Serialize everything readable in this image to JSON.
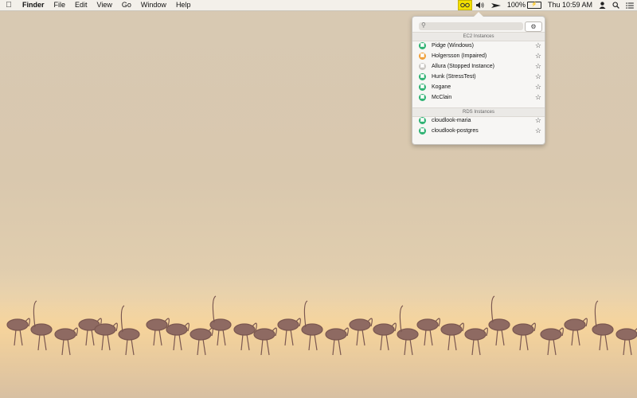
{
  "menubar": {
    "apple_icon": "apple-icon",
    "app_name": "Finder",
    "menus": [
      "File",
      "Edit",
      "View",
      "Go",
      "Window",
      "Help"
    ],
    "status": {
      "battery_percent": "100%",
      "clock": "Thu 10:59 AM"
    }
  },
  "popover": {
    "search_placeholder": "",
    "ec2_header": "EC2 Instances",
    "ec2_instances": [
      {
        "label": "Pidge (Windows)",
        "status_color": "#2fb273"
      },
      {
        "label": "Holgersson (Impaired)",
        "status_color": "#f0a03a"
      },
      {
        "label": "Allura (Stopped Instance)",
        "status_color": "#c9c7c3"
      },
      {
        "label": "Hunk (StressTest)",
        "status_color": "#2fb273"
      },
      {
        "label": "Kogane",
        "status_color": "#2fb273"
      },
      {
        "label": "McClain",
        "status_color": "#2fb273"
      }
    ],
    "rds_header": "RDS Instances",
    "rds_instances": [
      {
        "label": "cloudlook-maria",
        "status_color": "#2fb273"
      },
      {
        "label": "cloudlook-postgres",
        "status_color": "#2fb273"
      }
    ]
  },
  "colors": {
    "accent_yellow": "#f3e000",
    "running_green": "#2fb273",
    "impaired_orange": "#f0a03a",
    "stopped_gray": "#c9c7c3"
  }
}
